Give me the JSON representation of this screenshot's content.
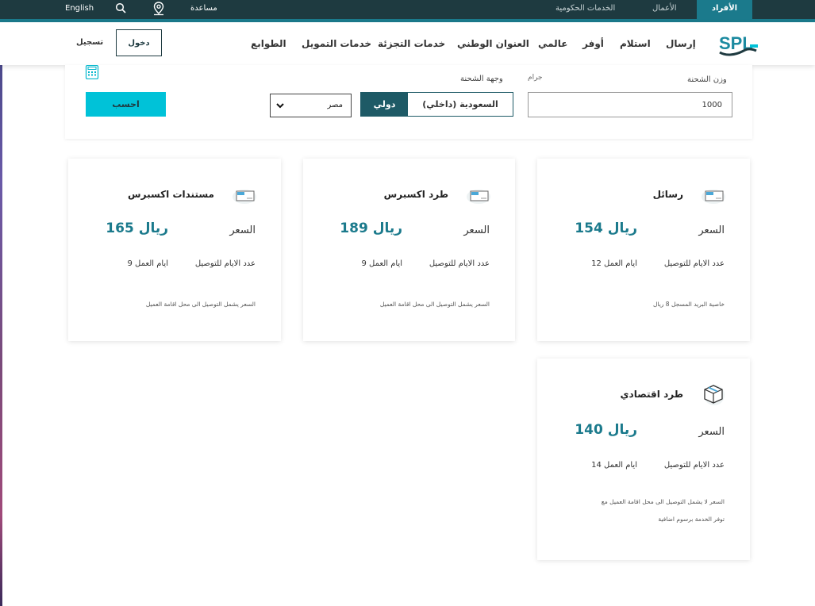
{
  "topbar": {
    "segments": {
      "individuals": "الأفراد",
      "business": "الأعمال",
      "government": "الخدمات الحكومية"
    },
    "help": "مساعدة",
    "language": "English"
  },
  "nav": {
    "items": [
      "إرسال",
      "استلام",
      "أوفر",
      "عالمي",
      "العنوان الوطني",
      "خدمات التجزئة",
      "خدمات التمويل",
      "الطوابع"
    ],
    "login": "دخول",
    "register": "تسجيل"
  },
  "calculator": {
    "weight_label": "وزن الشحنة",
    "weight_unit": "جرام",
    "weight_value": "1000",
    "destination_label": "وجهة الشحنة",
    "options": {
      "local": "السعودية (داخلي)",
      "international": "دولي"
    },
    "country_selected": "مصر",
    "calculate_button": "احسب"
  },
  "results": [
    {
      "title": "رسائل",
      "price_label": "السعر",
      "price": "154 ريال",
      "days_label": "عدد الايام للتوصيل",
      "days": "12 ايام العمل",
      "note": [
        "خاصية البريد المسجل 8 ريال"
      ]
    },
    {
      "title": "طرد اكسبرس",
      "price_label": "السعر",
      "price": "189 ريال",
      "days_label": "عدد الايام للتوصيل",
      "days": "9 ايام العمل",
      "note": [
        "السعر يشمل التوصيل الى محل اقامة العميل"
      ]
    },
    {
      "title": "مستندات اكسبرس",
      "price_label": "السعر",
      "price": "165 ريال",
      "days_label": "عدد الايام للتوصيل",
      "days": "9 ايام العمل",
      "note": [
        "السعر يشمل التوصيل الى محل اقامة العميل"
      ]
    },
    {
      "title": "طرد اقتصادي",
      "price_label": "السعر",
      "price": "140 ريال",
      "days_label": "عدد الايام للتوصيل",
      "days": "14 ايام العمل",
      "note": [
        "السعر لا يشمل التوصيل الى محل اقامة العميل مع",
        "توفر الخدمة برسوم اضافية"
      ]
    }
  ],
  "colors": {
    "topbar": "#1e3a40",
    "accent": "#1b7a8c",
    "calc_button": "#00c2d8"
  }
}
